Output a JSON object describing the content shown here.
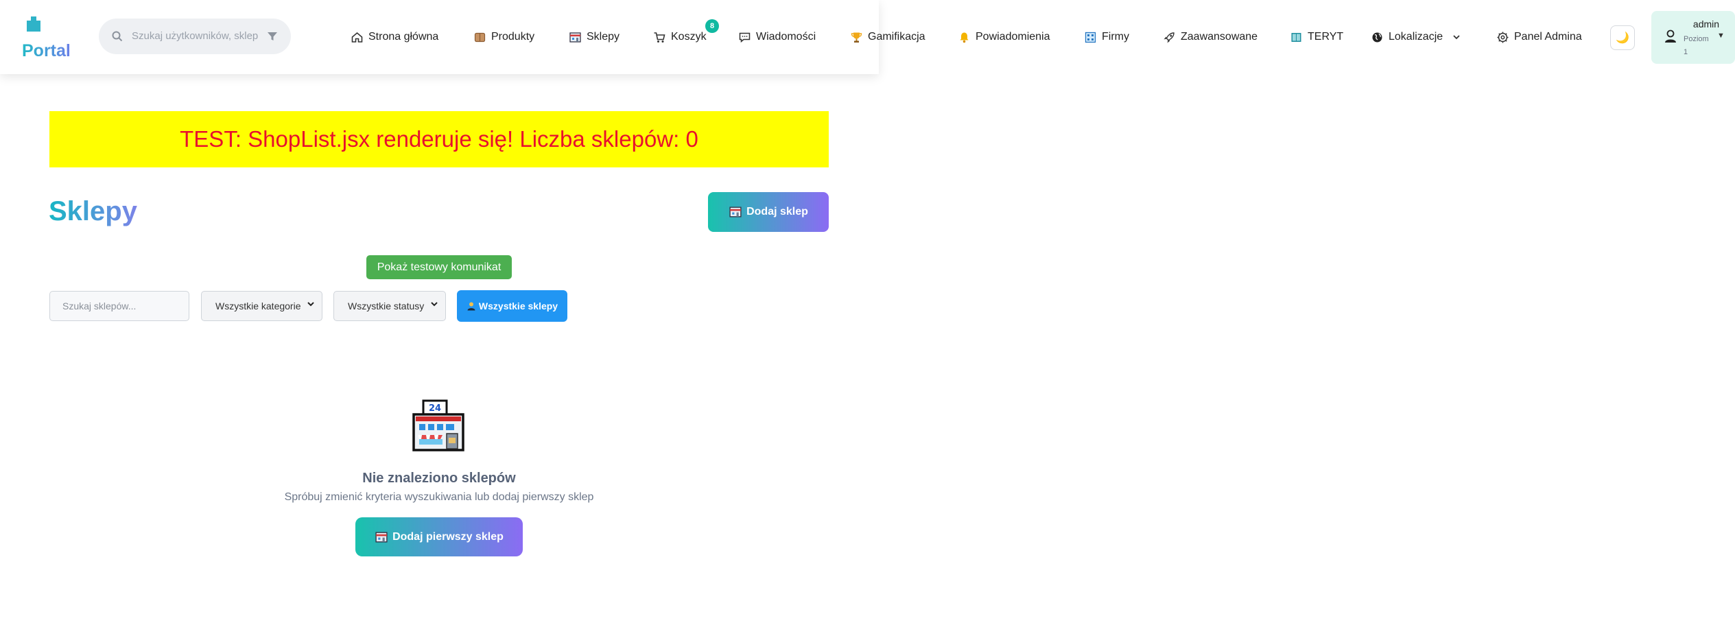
{
  "header": {
    "logo_text": "Portal",
    "search_placeholder": "Szukaj użytkowników, sklep",
    "nav": [
      {
        "label": "Strona główna",
        "icon": "home-icon"
      },
      {
        "label": "Produkty",
        "icon": "package-icon"
      },
      {
        "label": "Sklepy",
        "icon": "store-icon"
      },
      {
        "label": "Koszyk",
        "icon": "cart-icon",
        "badge": "8"
      },
      {
        "label": "Wiadomości",
        "icon": "chat-icon"
      },
      {
        "label": "Gamifikacja",
        "icon": "trophy-icon"
      },
      {
        "label": "Powiadomienia",
        "icon": "bell-icon"
      },
      {
        "label": "Firmy",
        "icon": "building-icon"
      },
      {
        "label": "Zaawansowane",
        "icon": "rocket-icon"
      },
      {
        "label": "TERYT",
        "icon": "map-book-icon"
      },
      {
        "label": "Lokalizacje",
        "icon": "globe-icon"
      },
      {
        "label": "Panel Admina",
        "icon": "gear-icon"
      }
    ],
    "theme_icon": "🌙",
    "user": {
      "name": "admin",
      "level": "Poziom 1"
    }
  },
  "banner": {
    "text": "TEST: ShopList.jsx renderuje się! Liczba sklepów: 0"
  },
  "page": {
    "title": "Sklepy",
    "add_button": "Dodaj sklep",
    "test_message_button": "Pokaż testowy komunikat"
  },
  "filters": {
    "search_placeholder": "Szukaj sklepów...",
    "category_selected": "Wszystkie kategorie",
    "status_selected": "Wszystkie statusy",
    "all_shops_button": "Wszystkie sklepy"
  },
  "empty_state": {
    "title": "Nie znaleziono sklepów",
    "subtitle": "Spróbuj zmienić kryteria wyszukiwania lub dodaj pierwszy sklep",
    "button": "Dodaj pierwszy sklep"
  },
  "colors": {
    "accent_teal": "#19c2ad",
    "accent_purple": "#8b6cf3",
    "banner_bg": "#ffff00",
    "banner_text": "#e8112d",
    "primary_blue": "#2196f3",
    "success_green": "#4caf50"
  }
}
